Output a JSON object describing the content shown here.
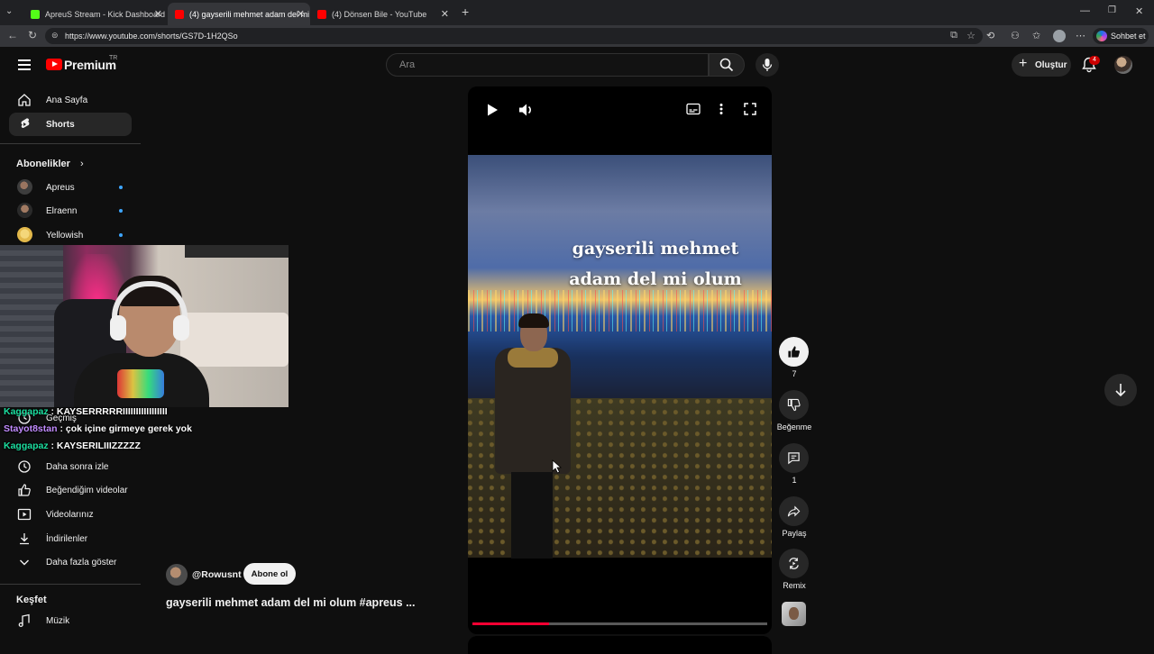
{
  "browser": {
    "tabs": [
      {
        "label": "ApreuS Stream - Kick Dashboard",
        "favicon_color": "#53fc18"
      },
      {
        "label": "(4) gayserili mehmet adam del mi",
        "favicon_color": "#ff0000"
      },
      {
        "label": "(4) Dönsen Bile - YouTube",
        "favicon_color": "#ff0000"
      }
    ],
    "url": "https://www.youtube.com/shorts/GS7D-1H2QSo",
    "copilot_label": "Sohbet et"
  },
  "header": {
    "brand": "Premium",
    "region": "TR",
    "search_placeholder": "Ara",
    "create_label": "Oluştur",
    "notification_count": "4"
  },
  "sidebar": {
    "main": [
      {
        "label": "Ana Sayfa",
        "icon": "home-icon"
      },
      {
        "label": "Shorts",
        "icon": "shorts-icon",
        "selected": true
      }
    ],
    "subscriptions_title": "Abonelikler",
    "subscriptions": [
      {
        "label": "Apreus"
      },
      {
        "label": "Elraenn"
      },
      {
        "label": "Yellowish"
      }
    ],
    "you": [
      {
        "label": "Geçmiş",
        "icon": "history-icon"
      },
      {
        "label": "Daha sonra izle",
        "icon": "clock-icon"
      },
      {
        "label": "Beğendiğim videolar",
        "icon": "thumb-up-icon"
      },
      {
        "label": "Videolarınız",
        "icon": "video-icon"
      },
      {
        "label": "İndirilenler",
        "icon": "download-icon"
      },
      {
        "label": "Daha fazla göster",
        "icon": "chevron-down-icon"
      }
    ],
    "explore_title": "Keşfet",
    "explore": [
      {
        "label": "Müzik",
        "icon": "music-icon"
      }
    ]
  },
  "chat": [
    {
      "user": "Kaggapaz",
      "message": ": KAYSERRRRRIIIIIIIIIIIIIIIII"
    },
    {
      "user": "Stayot8stan",
      "message": ": çok içine girmeye gerek yok"
    },
    {
      "user": "Kaggapaz",
      "message": ": KAYSERILIIIZZZZZ"
    }
  ],
  "short": {
    "overlay_line1": "gayserili mehmet",
    "overlay_line2": "adam del mi olum",
    "channel": "@Rowusnt",
    "subscribe_label": "Abone ol",
    "description": "gayserili mehmet adam del mi olum #apreus ...",
    "progress": 0.26
  },
  "actions": {
    "like_count": "7",
    "dislike_label": "Beğenme",
    "comment_count": "1",
    "share_label": "Paylaş",
    "remix_label": "Remix"
  },
  "colors": {
    "accent_red": "#ff0000",
    "progress_red": "#ff0033",
    "chat_user_green": "#1cdfa0",
    "chat_user_purple": "#c28bff",
    "subscription_dot": "#3ea6ff"
  }
}
